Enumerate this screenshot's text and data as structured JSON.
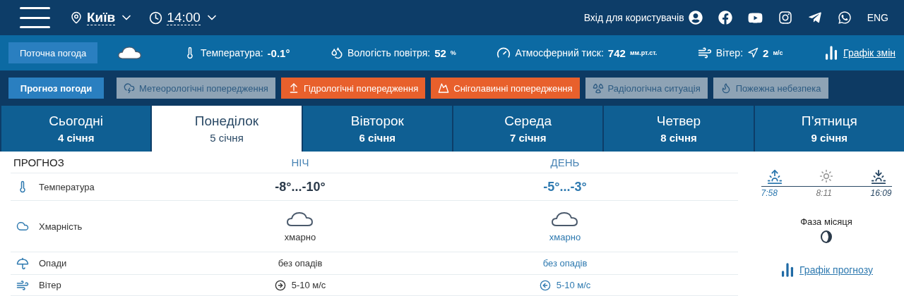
{
  "header": {
    "city": "Київ",
    "time": "14:00",
    "login": "Вхід для користувачів",
    "language": "ENG"
  },
  "current": {
    "button": "Поточна погода",
    "temperature": {
      "label": "Температура:",
      "value": "-0.1°"
    },
    "humidity": {
      "label": "Вологість повітря:",
      "value": "52",
      "unit": "%"
    },
    "pressure": {
      "label": "Атмосферний тиск:",
      "value": "742",
      "unit": "мм.рт.ст."
    },
    "wind": {
      "label": "Вітер:",
      "value": "2",
      "unit": "м/с"
    },
    "chart_link": "Графік змін"
  },
  "alerts": [
    {
      "label": "Прогноз погоди",
      "kind": "primary"
    },
    {
      "label": "Метеорологічні попередження",
      "kind": "inactive"
    },
    {
      "label": "Гідрологічні попередження",
      "kind": "active"
    },
    {
      "label": "Сніголавинні попередження",
      "kind": "active"
    },
    {
      "label": "Радіологічна ситуація",
      "kind": "inactive"
    },
    {
      "label": "Пожежна небезпека",
      "kind": "inactive"
    }
  ],
  "days": [
    {
      "name": "Сьогодні",
      "date": "4 січня",
      "selected": false
    },
    {
      "name": "Понеділок",
      "date": "5 січня",
      "selected": true
    },
    {
      "name": "Вівторок",
      "date": "6 січня",
      "selected": false
    },
    {
      "name": "Середа",
      "date": "7 січня",
      "selected": false
    },
    {
      "name": "Четвер",
      "date": "8 січня",
      "selected": false
    },
    {
      "name": "П’ятниця",
      "date": "9 січня",
      "selected": false
    }
  ],
  "forecast": {
    "title": "ПРОГНОЗ",
    "columns": [
      "НІЧ",
      "ДЕНЬ"
    ],
    "rows": [
      {
        "kind": "temperature",
        "label": "Температура",
        "values": [
          {
            "text": "-8°...-10°"
          },
          {
            "text": "-5°...-3°"
          }
        ]
      },
      {
        "kind": "cloud",
        "label": "Хмарність",
        "values": [
          {
            "text": "хмарно"
          },
          {
            "text": "хмарно"
          }
        ]
      },
      {
        "kind": "precipitation",
        "label": "Опади",
        "values": [
          {
            "text": "без опадів"
          },
          {
            "text": "без опадів"
          }
        ]
      },
      {
        "kind": "wind",
        "label": "Вітер",
        "values": [
          {
            "text": "5-10 м/с",
            "points_left": false
          },
          {
            "text": "5-10 м/с",
            "points_left": true
          }
        ]
      }
    ]
  },
  "sun": {
    "sunrise": "7:58",
    "noon": "8:11",
    "sunset": "16:09"
  },
  "moon": {
    "label": "Фаза місяця"
  },
  "forecast_chart_link": "Графік прогнозу"
}
